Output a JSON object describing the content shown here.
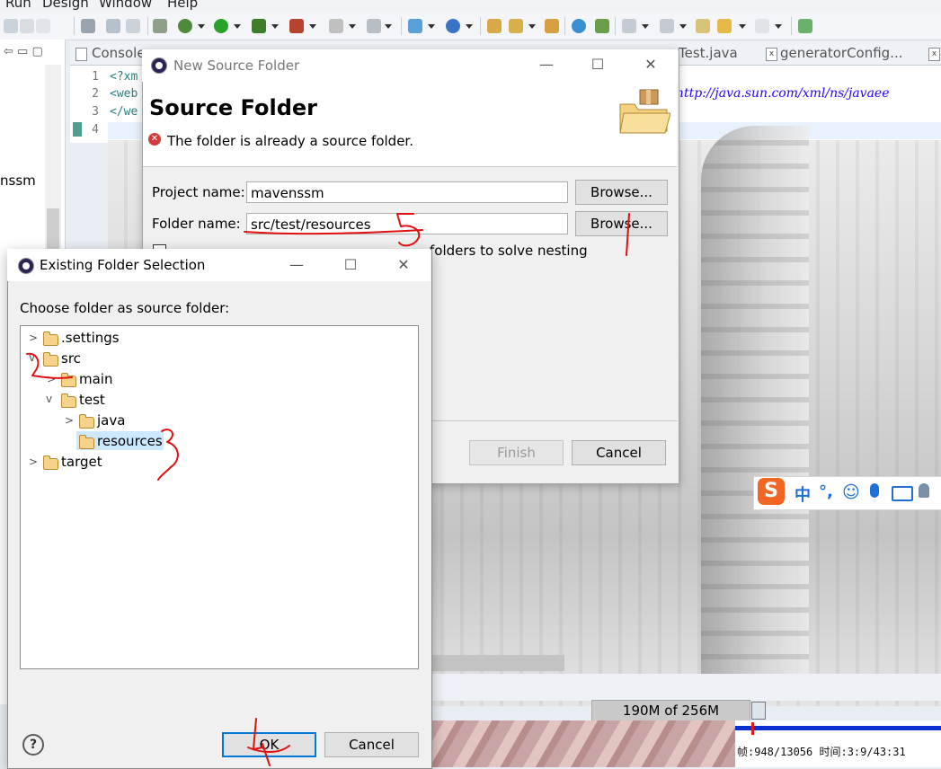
{
  "menubar": {
    "items": [
      "Run",
      "Design",
      "Window",
      "Help"
    ]
  },
  "toolbar": {
    "icons": [
      "new-icon",
      "debug-icon",
      "run-icon",
      "coverage-icon",
      "external-tools-icon",
      "search-icon",
      "open-type-icon",
      "open-task-icon",
      "web-browser-icon",
      "next-annotation-icon",
      "previous-annotation-icon",
      "back-icon",
      "forward-icon",
      "pin-editor-icon"
    ]
  },
  "editor_tabs": [
    "Console",
    "Test.java",
    "generatorConfig..."
  ],
  "editor": {
    "line_numbers": [
      "1",
      "2",
      "3",
      "4"
    ],
    "lines": [
      "<?xm",
      "<web",
      "</we"
    ],
    "url_fragment": "http://java.sun.com/xml/ns/javaee"
  },
  "left_panel": {
    "visible_text": "nssm"
  },
  "status": {
    "heap": "190M of 256M"
  },
  "player": {
    "text": "帧:948/13056 时间:3:9/43:31"
  },
  "ime": {
    "logo": "S",
    "items": [
      "中",
      "°,"
    ]
  },
  "new_source_folder": {
    "window_title": "New Source Folder",
    "heading": "Source Folder",
    "error_message": "The folder is already a source folder.",
    "project_label": "Project name:",
    "project_value": "mavenssm",
    "folder_label": "Folder name:",
    "folder_value": "src/test/resources",
    "browse_label": "Browse...",
    "checkbox_label_fragment": "folders to solve nesting",
    "finish_label": "Finish",
    "cancel_label": "Cancel"
  },
  "existing_folder_selection": {
    "window_title": "Existing Folder Selection",
    "prompt": "Choose folder as source folder:",
    "tree": [
      ".settings",
      "src",
      "main",
      "test",
      "java",
      "resources",
      "target"
    ],
    "ok_label": "OK",
    "cancel_label": "Cancel",
    "help_label": "?"
  },
  "annotations": [
    "1",
    "2",
    "3",
    "4",
    "5"
  ]
}
